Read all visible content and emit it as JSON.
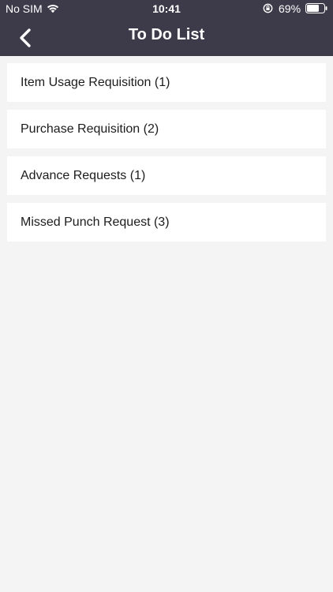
{
  "status_bar": {
    "carrier": "No SIM",
    "time": "10:41",
    "battery_percent": "69%",
    "icons": [
      "wifi-icon",
      "rotation-lock-icon",
      "battery-icon"
    ]
  },
  "nav": {
    "title": "To Do List",
    "back_icon": "chevron-left-icon"
  },
  "todo_items": [
    {
      "label": "Item Usage Requisition (1)"
    },
    {
      "label": "Purchase Requisition (2)"
    },
    {
      "label": "Advance Requests (1)"
    },
    {
      "label": "Missed Punch Request (3)"
    }
  ],
  "colors": {
    "header_bg": "#3d3b4a",
    "page_bg": "#f4f4f4",
    "card_bg": "#ffffff",
    "text": "#1c1c1c",
    "header_text": "#ffffff"
  }
}
